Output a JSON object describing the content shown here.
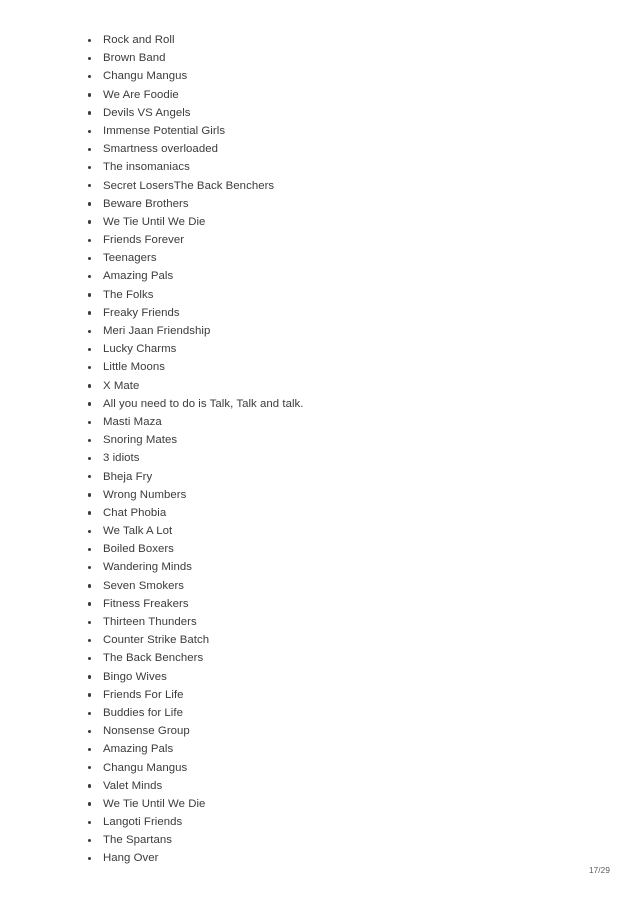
{
  "document": {
    "page_label": "17/29",
    "text_color": "#3b3b3b",
    "background_color": "#ffffff",
    "bullet_color": "#3b3b3b"
  },
  "list": {
    "items": [
      {
        "label": "Rock and Roll"
      },
      {
        "label": "Brown Band"
      },
      {
        "label": "Changu Mangus"
      },
      {
        "label": "We Are Foodie"
      },
      {
        "label": "Devils VS Angels"
      },
      {
        "label": "Immense Potential Girls"
      },
      {
        "label": "Smartness overloaded"
      },
      {
        "label": "The insomaniacs"
      },
      {
        "label": "Secret LosersThe Back Benchers"
      },
      {
        "label": "Beware Brothers"
      },
      {
        "label": "We Tie Until We Die"
      },
      {
        "label": "Friends Forever"
      },
      {
        "label": "Teenagers"
      },
      {
        "label": "Amazing Pals"
      },
      {
        "label": "The Folks"
      },
      {
        "label": "Freaky Friends"
      },
      {
        "label": "Meri Jaan Friendship"
      },
      {
        "label": "Lucky Charms"
      },
      {
        "label": "Little Moons"
      },
      {
        "label": "X Mate"
      },
      {
        "label": "All you need to do is Talk, Talk and talk."
      },
      {
        "label": "Masti Maza"
      },
      {
        "label": "Snoring Mates"
      },
      {
        "label": "3 idiots"
      },
      {
        "label": "Bheja Fry"
      },
      {
        "label": "Wrong Numbers"
      },
      {
        "label": "Chat Phobia"
      },
      {
        "label": "We Talk A Lot"
      },
      {
        "label": "Boiled Boxers"
      },
      {
        "label": "Wandering Minds"
      },
      {
        "label": "Seven Smokers"
      },
      {
        "label": "Fitness Freakers"
      },
      {
        "label": "Thirteen Thunders"
      },
      {
        "label": "Counter Strike Batch"
      },
      {
        "label": "The Back Benchers"
      },
      {
        "label": "Bingo Wives"
      },
      {
        "label": "Friends For Life"
      },
      {
        "label": "Buddies for Life"
      },
      {
        "label": "Nonsense Group"
      },
      {
        "label": "Amazing Pals"
      },
      {
        "label": "Changu Mangus"
      },
      {
        "label": "Valet Minds"
      },
      {
        "label": "We Tie Until We Die"
      },
      {
        "label": "Langoti Friends"
      },
      {
        "label": "The Spartans"
      },
      {
        "label": "Hang Over"
      }
    ]
  }
}
